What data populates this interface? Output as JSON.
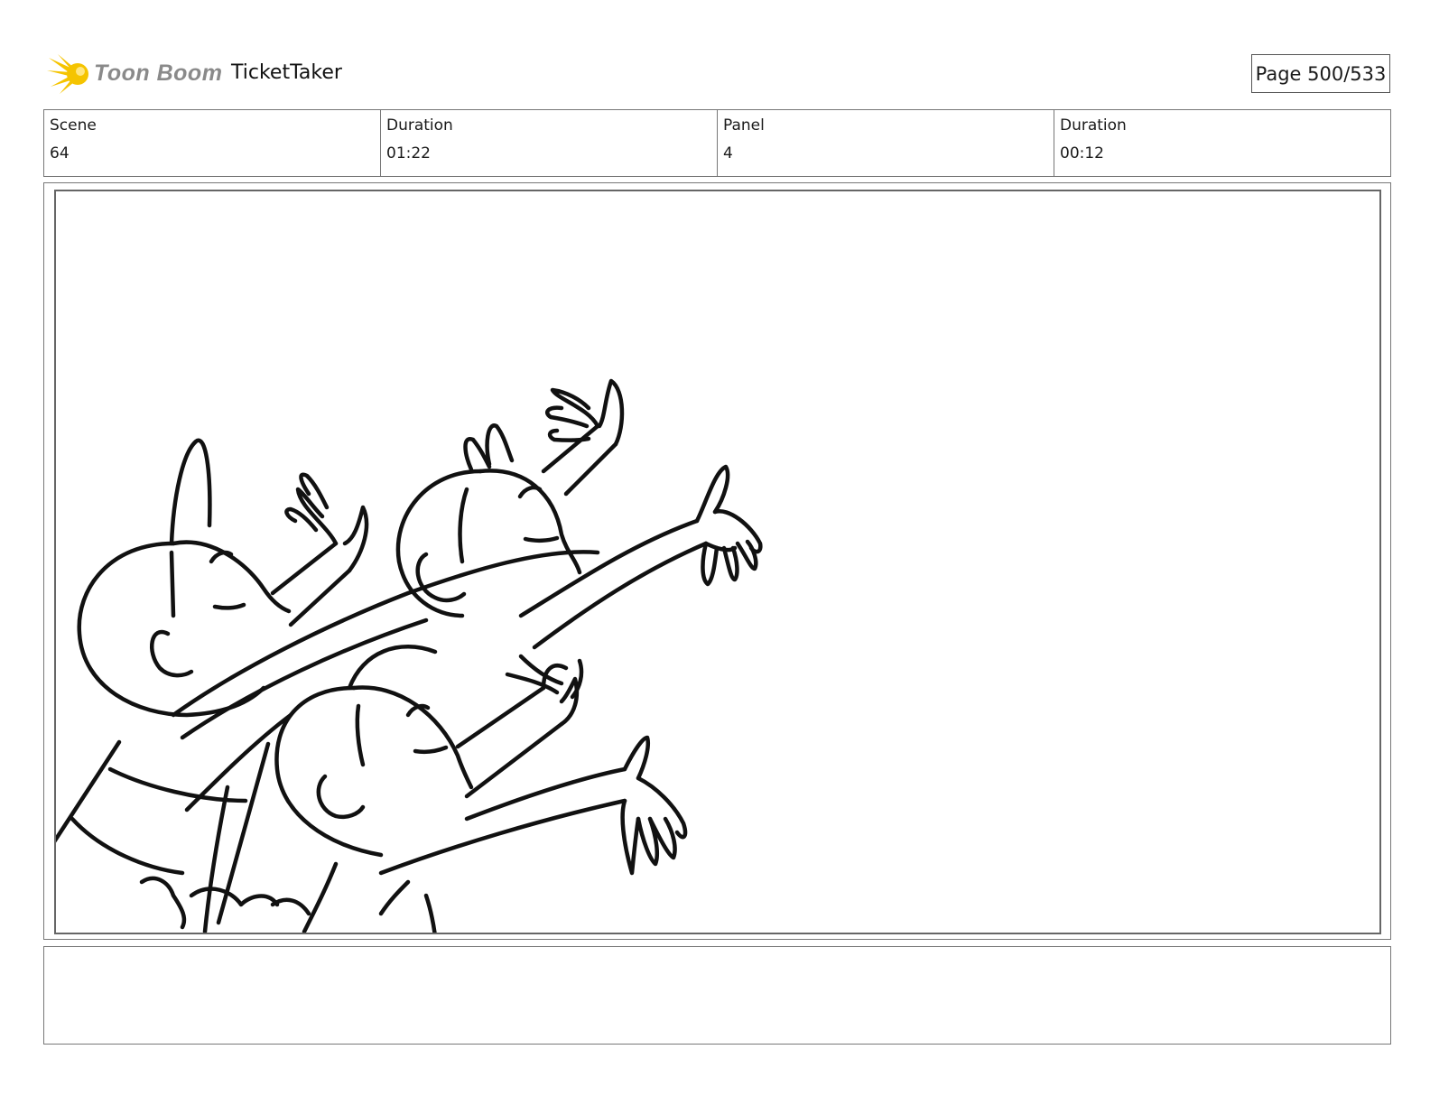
{
  "header": {
    "logo_text": "Toon Boom",
    "project_title": "TicketTaker",
    "page_label": "Page 500/533"
  },
  "info": {
    "scene_label": "Scene",
    "scene_value": "64",
    "scene_duration_label": "Duration",
    "scene_duration_value": "01:22",
    "panel_label": "Panel",
    "panel_value": "4",
    "panel_duration_label": "Duration",
    "panel_duration_value": "00:12"
  },
  "colors": {
    "logo_yellow": "#f5c400",
    "logo_gray": "#8a8a8a"
  }
}
